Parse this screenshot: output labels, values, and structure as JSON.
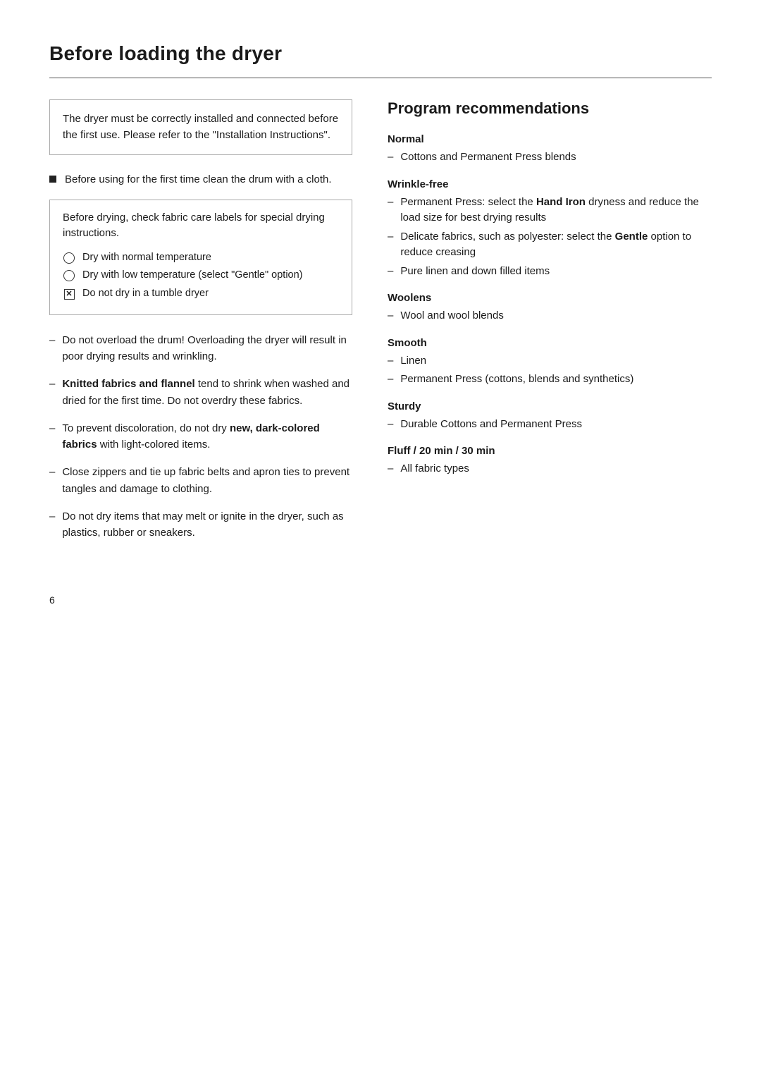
{
  "page": {
    "title": "Before loading the dryer",
    "page_number": "6"
  },
  "left": {
    "info_box": "The dryer must be correctly installed and connected before the first use. Please refer to the \"Installation Instructions\".",
    "bullet_item": "Before using for the first time clean the drum with a cloth.",
    "fabric_care_box": {
      "intro": "Before drying, check fabric care labels for special drying instructions.",
      "symbols": [
        {
          "type": "circle",
          "text": "Dry with normal temperature"
        },
        {
          "type": "circle",
          "text": "Dry with low temperature (select \"Gentle\" option)"
        },
        {
          "type": "checkbox",
          "text": "Do not dry in a tumble dryer"
        }
      ]
    },
    "dash_items": [
      {
        "id": 1,
        "text": "Do not overload the drum! Overloading the dryer will result in poor drying results and wrinkling."
      },
      {
        "id": 2,
        "text_before": "",
        "bold": "Knitted fabrics and flannel",
        "text_after": " tend to shrink when washed and dried for the first time. Do not overdry these fabrics."
      },
      {
        "id": 3,
        "text_before": "To prevent discoloration, do not dry ",
        "bold": "new, dark-colored fabrics",
        "text_after": " with light-colored items."
      },
      {
        "id": 4,
        "text": "Close zippers and tie up fabric belts and apron ties to prevent tangles and damage to clothing."
      },
      {
        "id": 5,
        "text": "Do not dry items that may melt or ignite in the dryer, such as plastics, rubber or sneakers."
      }
    ]
  },
  "right": {
    "section_title": "Program recommendations",
    "programs": [
      {
        "heading": "Normal",
        "items": [
          {
            "text": "Cottons and Permanent Press blends"
          }
        ]
      },
      {
        "heading": "Wrinkle-free",
        "items": [
          {
            "text_before": "Permanent Press: select the ",
            "bold": "Hand Iron",
            "text_after": " dryness and reduce the load size for best drying results"
          },
          {
            "text_before": "Delicate fabrics, such as polyester: select the ",
            "bold": "Gentle",
            "text_after": " option to reduce creasing"
          },
          {
            "text": "Pure linen and down filled items"
          }
        ]
      },
      {
        "heading": "Woolens",
        "items": [
          {
            "text": "Wool and wool blends"
          }
        ]
      },
      {
        "heading": "Smooth",
        "items": [
          {
            "text": "Linen"
          },
          {
            "text": "Permanent Press (cottons, blends and synthetics)"
          }
        ]
      },
      {
        "heading": "Sturdy",
        "items": [
          {
            "text": "Durable Cottons and Permanent Press"
          }
        ]
      },
      {
        "heading": "Fluff / 20 min / 30 min",
        "items": [
          {
            "text": "All fabric types"
          }
        ]
      }
    ]
  }
}
